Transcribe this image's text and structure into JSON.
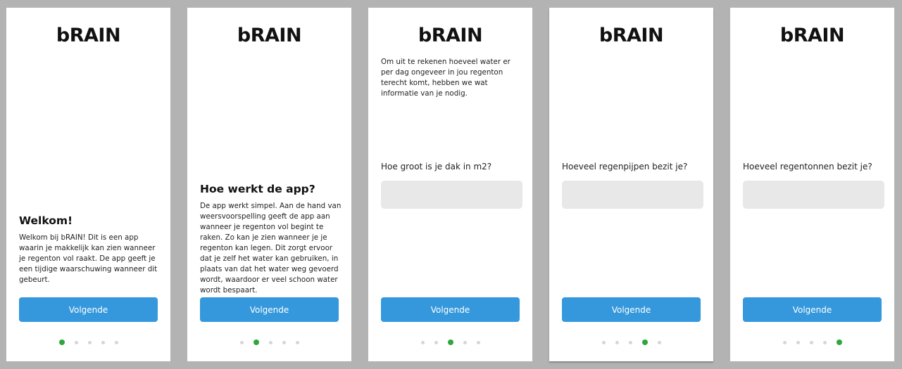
{
  "app": {
    "logo": "bRAIN"
  },
  "screens": [
    {
      "heading": "Welkom!",
      "body": "Welkom bij bRAIN! Dit is een app waarin je makkelijk kan zien wanneer je regenton vol raakt. De app geeft je een tijdige waarschuwing wanneer dit gebeurt.",
      "button": "Volgende",
      "active_dot": 1
    },
    {
      "heading": "Hoe werkt de app?",
      "body": "De app werkt simpel. Aan de hand van weersvoorspelling geeft de app aan wanneer je regenton vol begint te raken. Zo kan je zien wanneer je je regenton kan legen. Dit zorgt ervoor dat je zelf het water kan gebruiken, in plaats van dat het water weg gevoerd wordt, waardoor er veel schoon water wordt bespaart.",
      "button": "Volgende",
      "active_dot": 2
    },
    {
      "intro": "Om uit te rekenen hoeveel water er per dag ongeveer in jou regenton terecht komt, hebben we wat informatie van je nodig.",
      "question": "Hoe groot is je dak in m2?",
      "input_value": "",
      "button": "Volgende",
      "active_dot": 3
    },
    {
      "question": "Hoeveel regenpijpen bezit je?",
      "input_value": "",
      "button": "Volgende",
      "active_dot": 4
    },
    {
      "question": "Hoeveel regentonnen bezit je?",
      "input_value": "",
      "button": "Volgende",
      "active_dot": 5
    }
  ],
  "colors": {
    "background": "#b3b3b3",
    "button": "#3598dc",
    "active_dot": "#2ea83a",
    "inactive_dot": "#d6d6d6",
    "input": "#e8e8e8"
  }
}
